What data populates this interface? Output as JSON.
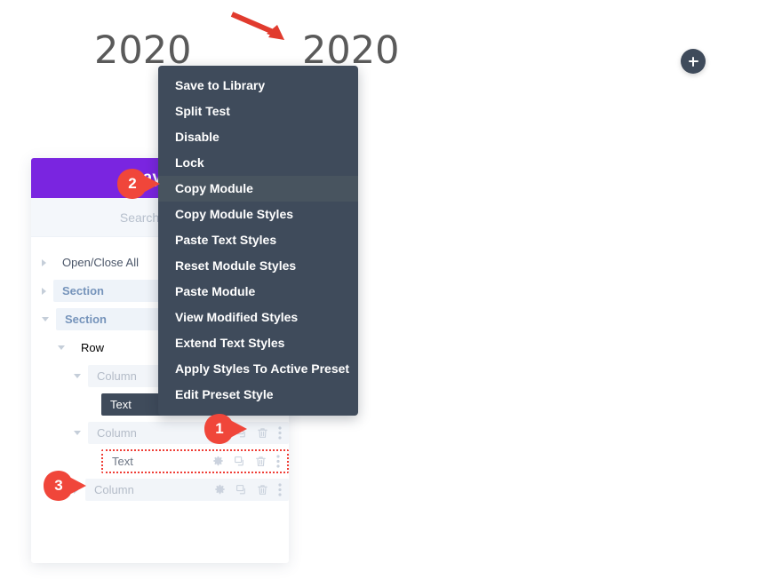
{
  "canvas": {
    "year_left": "2020",
    "year_right": "2020",
    "arrow_icon": "red-arrow-down-right-icon",
    "add_button_icon": "plus-icon",
    "accent_red": "#ef3e36",
    "heading_color": "#5a5a5a",
    "add_button_color": "#3f4b5b"
  },
  "layers_panel": {
    "title": "Layers",
    "header_color": "#7a25e0",
    "search": {
      "placeholder": "Search Layers",
      "value": ""
    },
    "rows": [
      {
        "label": "Open/Close All",
        "type": "openclose",
        "twisty": "closed",
        "indent": 0,
        "icons": []
      },
      {
        "label": "Section",
        "type": "section",
        "twisty": "closed",
        "indent": 1,
        "icons": []
      },
      {
        "label": "Section",
        "type": "section",
        "twisty": "open",
        "indent": 1,
        "icons": []
      },
      {
        "label": "Row",
        "type": "row",
        "twisty": "open",
        "indent": 2,
        "icons": []
      },
      {
        "label": "Column",
        "type": "column",
        "twisty": "open",
        "indent": 3,
        "icons": []
      },
      {
        "label": "Text",
        "type": "text-active",
        "twisty": "none",
        "indent": 4,
        "icons": [
          "gear-icon",
          "ellipsis-vertical-icon"
        ]
      },
      {
        "label": "Column",
        "type": "column",
        "twisty": "open",
        "indent": 3,
        "icons": [
          "gear-icon",
          "duplicate-icon",
          "trash-icon",
          "ellipsis-vertical-icon"
        ]
      },
      {
        "label": "Text",
        "type": "text-dotted",
        "twisty": "none",
        "indent": 4,
        "icons": [
          "gear-icon",
          "duplicate-icon",
          "trash-icon",
          "ellipsis-vertical-icon"
        ]
      },
      {
        "label": "Column",
        "type": "column",
        "twisty": "closed",
        "indent": 3,
        "icons": [
          "gear-icon",
          "duplicate-icon",
          "trash-icon",
          "ellipsis-vertical-icon"
        ]
      }
    ]
  },
  "context_menu": {
    "background": "#3f4b5b",
    "active_item": "Copy Module",
    "items": [
      {
        "label": "Save to Library",
        "active": false
      },
      {
        "label": "Split Test",
        "active": false
      },
      {
        "label": "Disable",
        "active": false
      },
      {
        "label": "Lock",
        "active": false
      },
      {
        "label": "Copy Module",
        "active": true
      },
      {
        "label": "Copy Module Styles",
        "active": false
      },
      {
        "label": "Paste Text Styles",
        "active": false
      },
      {
        "label": "Reset Module Styles",
        "active": false
      },
      {
        "label": "Paste Module",
        "active": false
      },
      {
        "label": "View Modified Styles",
        "active": false
      },
      {
        "label": "Extend Text Styles",
        "active": false
      },
      {
        "label": "Apply Styles To Active Preset",
        "active": false
      },
      {
        "label": "Edit Preset Style",
        "active": false
      }
    ]
  },
  "markers": [
    {
      "number": "1"
    },
    {
      "number": "2"
    },
    {
      "number": "3"
    }
  ]
}
